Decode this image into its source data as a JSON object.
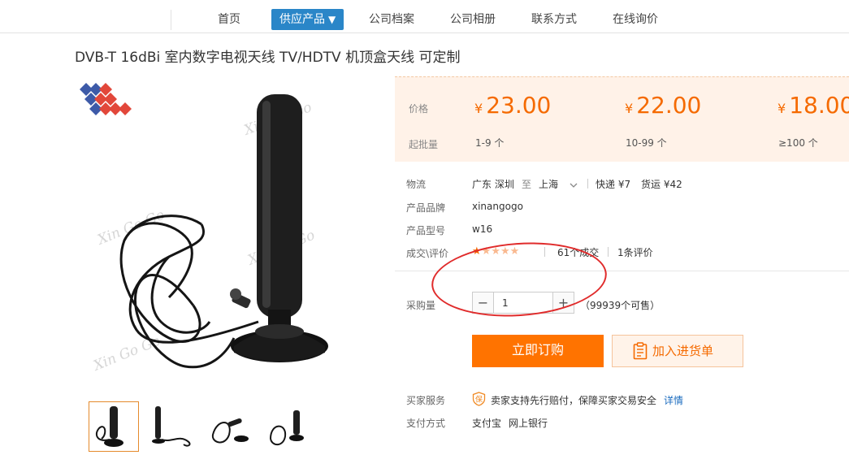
{
  "nav": {
    "items": [
      "首页",
      "供应产品",
      "公司档案",
      "公司相册",
      "联系方式",
      "在线询价"
    ],
    "active_caret": "▼"
  },
  "product": {
    "title": "DVB-T 16dBi 室内数字电视天线 TV/HDTV 机顶盒天线 可定制",
    "watermark": "Xin Go Go"
  },
  "price": {
    "price_label": "价格",
    "moq_label": "起批量",
    "currency": "¥",
    "tiers": [
      {
        "price": "23.00",
        "qty": "1-9 个"
      },
      {
        "price": "22.00",
        "qty": "10-99 个"
      },
      {
        "price": "18.00",
        "qty": "≥100 个"
      }
    ]
  },
  "logistics": {
    "label": "物流",
    "from": "广东 深圳",
    "to_word": "至",
    "to": "上海",
    "express": "快递 ¥7",
    "freight": "货运 ¥42"
  },
  "brand": {
    "label": "产品品牌",
    "value": "xinangogo"
  },
  "model": {
    "label": "产品型号",
    "value": "w16"
  },
  "deals": {
    "label": "成交\\评价",
    "rating": 1,
    "rating_max": 5,
    "deal_count": "61",
    "deal_text": "个成交",
    "review_count": "1",
    "review_text": "条评价"
  },
  "purchase": {
    "label": "采购量",
    "quantity": "1",
    "minus": "−",
    "plus": "+",
    "available": "（99939个可售）"
  },
  "buttons": {
    "order": "立即订购",
    "cart": "加入进货单"
  },
  "service": {
    "label": "买家服务",
    "badge": "保",
    "text": "卖家支持先行赔付，保障买家交易安全",
    "link": "详情"
  },
  "payment": {
    "label": "支付方式",
    "methods": [
      "支付宝",
      "网上银行"
    ]
  },
  "colors": {
    "accent_orange": "#ff7300",
    "nav_active_blue": "#2a86c8",
    "price_bg": "#fff2e8",
    "annotation_red": "#e02b2b"
  }
}
